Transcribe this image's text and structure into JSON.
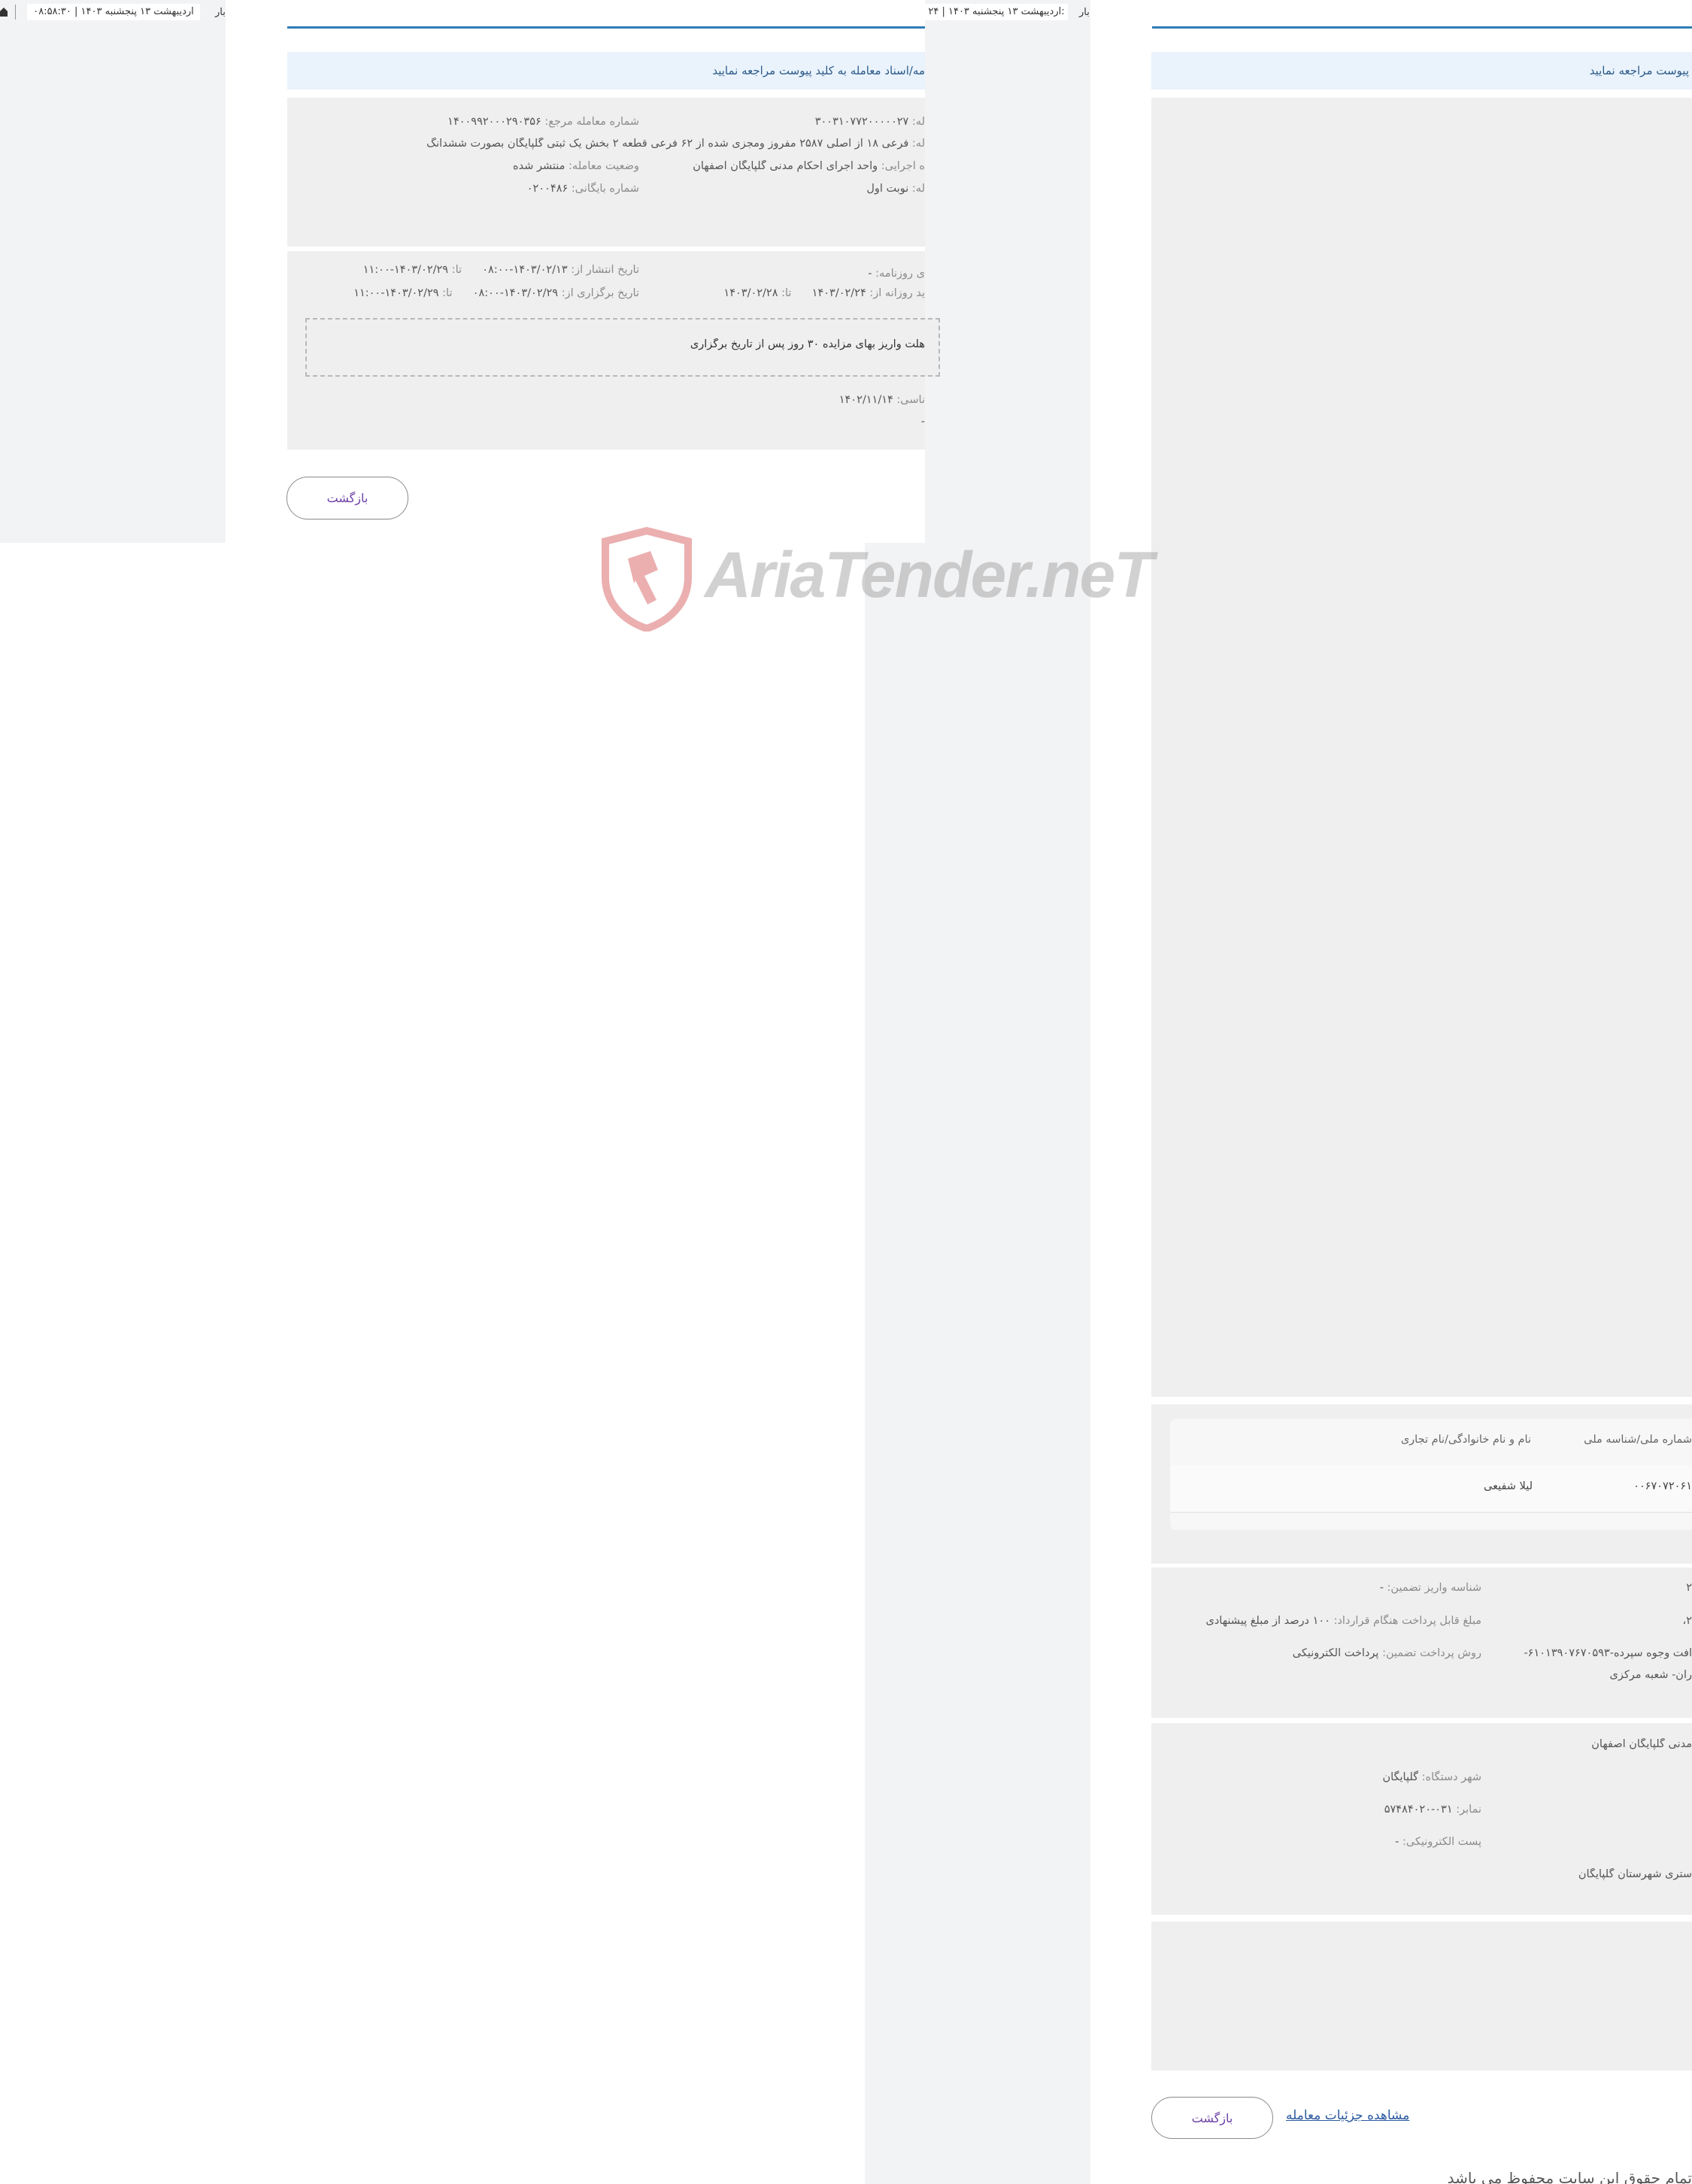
{
  "window_left": {
    "date_text": "اردیبهشت ۱۳ پنجشنبه ۱۴۰۳ | ۰۸:۵۸:۳۰",
    "edge_text": "بار"
  },
  "window_middle": {
    "date_text": "اردیبهشت ۱۳ پنجشنبه ۱۴۰۳ | ۲۴:",
    "edge_text": "بار",
    "info_bar": "مه/اسناد معامله به کلید پیوست مراجعه نمایید",
    "details": {
      "ref_number_label": "شماره معامله مرجع:",
      "ref_number_value": "۱۴۰۰۹۹۲۰۰۰۲۹۰۳۵۶",
      "number_label": "له:",
      "number_value": "۳۰۰۳۱۰۷۷۲۰۰۰۰۰۲۷",
      "title_label": "له:",
      "title_value": "فرعی ۱۸ از اصلی ۲۵۸۷ مفروز ومجزی شده از ۶۲ فرعی قطعه ۲ بخش یک ثبتی گلپایگان بصورت ششدانگ",
      "status_label": "وضعیت معامله:",
      "status_value": "منتشر شده",
      "exec_label": "ه اجرایی:",
      "exec_value": "واحد اجرای احکام مدنی گلپایگان اصفهان",
      "archive_label": "شماره بایگانی:",
      "archive_value": "۰۲۰۰۴۸۶",
      "round_label": "له:",
      "round_value": "نوبت اول"
    },
    "dates": {
      "publish_label": "تاریخ انتشار از:",
      "publish_from": "۱۴۰۳/۰۲/۱۳-۰۸:۰۰",
      "publish_to_label": "تا:",
      "publish_to": "۱۴۰۳/۰۲/۲۹-۱۱:۰۰",
      "newspaper_label": "ی روزنامه:",
      "newspaper_value": "-",
      "hold_label": "تاریخ برگزاری از:",
      "hold_from": "۱۴۰۳/۰۲/۲۹-۰۸:۰۰",
      "hold_to_label": "تا:",
      "hold_to": "۱۴۰۳/۰۲/۲۹-۱۱:۰۰",
      "visit_label": "ید روزانه از:",
      "visit_from": "۱۴۰۳/۰۲/۲۴",
      "visit_to_label": "تا:",
      "visit_to": "۱۴۰۳/۰۲/۲۸",
      "dashed_text": "هلت واریز بهای مزایده ۳۰ روز پس از تاریخ برگزاری",
      "id_label": "ناسی:",
      "id_value": "۱۴۰۲/۱۱/۱۴",
      "dash_label": "",
      "dash_value": "-"
    },
    "back_button": "بازگشت"
  },
  "window_right": {
    "info_bar": "پیوست مراجعه نمایید",
    "table": {
      "col1": "نام و نام خانوادگی/نام تجاری",
      "col2": "شماره ملی/شناسه ملی",
      "row1_col1": "لیلا شفیعی",
      "row1_col2": "۰۰۶۷۰۷۲۰۶۱"
    },
    "guarantee": {
      "deposit_label": "شناسه واریز تضمین:",
      "deposit_value": "-",
      "payable_label": "مبلغ قابل پرداخت هنگام قرارداد:",
      "payable_value": "۱۰۰ درصد از مبلغ پیشنهادی",
      "method_label": "روش پرداخت تضمین:",
      "method_value": "پرداخت الکترونیکی",
      "right_frag1": "۲",
      "right_frag2": "۲،",
      "right_frag3": "افت وجوه سپرده-۶۱۰۱۳۹۰۷۶۷۰۵۹۳-",
      "right_frag4": "ران- شعبه مرکزی"
    },
    "org": {
      "name_frag": "مدنی گلپایگان اصفهان",
      "city_label": "شهر دستگاه:",
      "city_value": "گلپایگان",
      "fax_label": "نمابر:",
      "fax_value": "۰۳۱-۵۷۴۸۴۰۲۰",
      "email_label": "پست الکترونیکی:",
      "email_value": "-",
      "court_frag": "ستری شهرستان گلپایگان"
    },
    "details_link": "مشاهده جزئیات معامله",
    "back_button": "بازگشت"
  },
  "footer_text": "تمام حقوق این سایت محفوظ می باشد",
  "watermark": "AriaTender.neT",
  "colors": {
    "accent_blue": "#2f7db5",
    "info_bg": "#eaf3fc",
    "button_text": "#6a3ea6",
    "watermark_red": "#d35050"
  }
}
